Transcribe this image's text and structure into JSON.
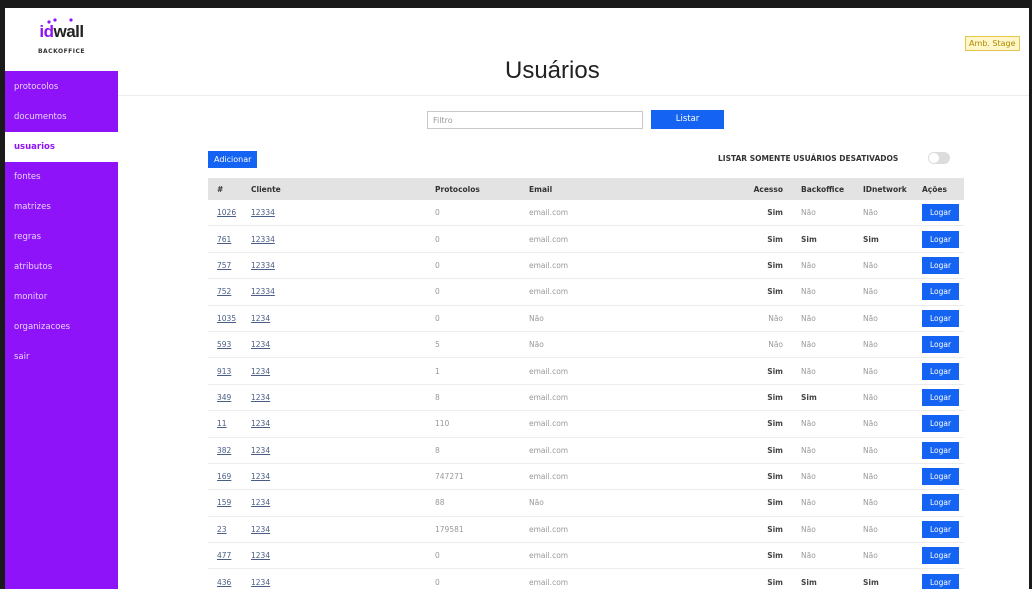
{
  "brand": {
    "logo_id": "id",
    "logo_wall": "wall",
    "logo_sub": "BACKOFFICE",
    "accent": "#8f13f8",
    "primary_button": "#1463f3"
  },
  "sidebar": {
    "items": [
      {
        "label": "protocolos",
        "active": false
      },
      {
        "label": "documentos",
        "active": false
      },
      {
        "label": "usuarios",
        "active": true
      },
      {
        "label": "fontes",
        "active": false
      },
      {
        "label": "matrizes",
        "active": false
      },
      {
        "label": "regras",
        "active": false
      },
      {
        "label": "atributos",
        "active": false
      },
      {
        "label": "monitor",
        "active": false
      },
      {
        "label": "organizacoes",
        "active": false
      },
      {
        "label": "sair",
        "active": false
      }
    ]
  },
  "header": {
    "title": "Usuários",
    "env_badge": "Amb. Stage"
  },
  "filter": {
    "placeholder": "Filtro",
    "value": "",
    "list_label": "Listar"
  },
  "toolbar": {
    "add_label": "Adicionar",
    "toggle_label": "LISTAR SOMENTE USUÁRIOS DESATIVADOS",
    "toggle_on": false
  },
  "table": {
    "columns": [
      "#",
      "Cliente",
      "Protocolos",
      "Email",
      "Acesso",
      "Backoffice",
      "IDnetwork",
      "Ações"
    ],
    "action_label": "Logar",
    "rows": [
      {
        "id": "1026",
        "cliente": "12334",
        "protocolos": "0",
        "email": "email.com",
        "acesso": "Sim",
        "backoffice": "Não",
        "idnetwork": "Não"
      },
      {
        "id": "761",
        "cliente": "12334",
        "protocolos": "0",
        "email": "email.com",
        "acesso": "Sim",
        "backoffice": "Sim",
        "idnetwork": "Sim"
      },
      {
        "id": "757",
        "cliente": "12334",
        "protocolos": "0",
        "email": "email.com",
        "acesso": "Sim",
        "backoffice": "Não",
        "idnetwork": "Não"
      },
      {
        "id": "752",
        "cliente": "12334",
        "protocolos": "0",
        "email": "email.com",
        "acesso": "Sim",
        "backoffice": "Não",
        "idnetwork": "Não"
      },
      {
        "id": "1035",
        "cliente": "1234",
        "protocolos": "0",
        "email": "Não",
        "acesso": "Não",
        "backoffice": "Não",
        "idnetwork": "Não"
      },
      {
        "id": "593",
        "cliente": "1234",
        "protocolos": "5",
        "email": "Não",
        "acesso": "Não",
        "backoffice": "Não",
        "idnetwork": "Não"
      },
      {
        "id": "913",
        "cliente": "1234",
        "protocolos": "1",
        "email": "email.com",
        "acesso": "Sim",
        "backoffice": "Não",
        "idnetwork": "Não"
      },
      {
        "id": "349",
        "cliente": "1234",
        "protocolos": "8",
        "email": "email.com",
        "acesso": "Sim",
        "backoffice": "Sim",
        "idnetwork": "Não"
      },
      {
        "id": "11",
        "cliente": "1234",
        "protocolos": "110",
        "email": "email.com",
        "acesso": "Sim",
        "backoffice": "Não",
        "idnetwork": "Não"
      },
      {
        "id": "382",
        "cliente": "1234",
        "protocolos": "8",
        "email": "email.com",
        "acesso": "Sim",
        "backoffice": "Não",
        "idnetwork": "Não"
      },
      {
        "id": "169",
        "cliente": "1234",
        "protocolos": "747271",
        "email": "email.com",
        "acesso": "Sim",
        "backoffice": "Não",
        "idnetwork": "Não"
      },
      {
        "id": "159",
        "cliente": "1234",
        "protocolos": "88",
        "email": "Não",
        "acesso": "Sim",
        "backoffice": "Não",
        "idnetwork": "Não"
      },
      {
        "id": "23",
        "cliente": "1234",
        "protocolos": "179581",
        "email": "email.com",
        "acesso": "Sim",
        "backoffice": "Não",
        "idnetwork": "Não"
      },
      {
        "id": "477",
        "cliente": "1234",
        "protocolos": "0",
        "email": "email.com",
        "acesso": "Sim",
        "backoffice": "Não",
        "idnetwork": "Não"
      },
      {
        "id": "436",
        "cliente": "1234",
        "protocolos": "0",
        "email": "email.com",
        "acesso": "Sim",
        "backoffice": "Sim",
        "idnetwork": "Sim"
      }
    ]
  }
}
